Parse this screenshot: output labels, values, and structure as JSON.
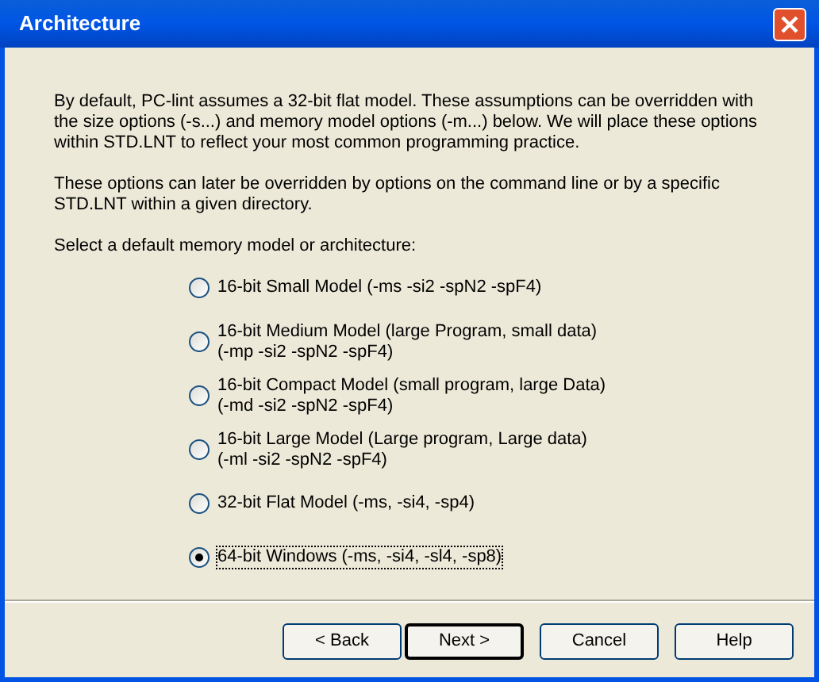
{
  "window": {
    "title": "Architecture"
  },
  "paragraphs": [
    "By default, PC-lint assumes a 32-bit flat model.  These assumptions can be overridden with the size options (-s...) and memory model options (-m...) below.  We will place these options within STD.LNT to reflect your most common programming practice.",
    "These options can later be overridden by options on the command line or by a specific STD.LNT within a given directory."
  ],
  "prompt": "Select a default memory model or architecture:",
  "options": [
    {
      "lines": [
        "16-bit Small Model (-ms -si2 -spN2 -spF4)"
      ],
      "selected": false
    },
    {
      "lines": [
        "16-bit Medium Model (large Program, small data)",
        "(-mp -si2 -spN2 -spF4)"
      ],
      "selected": false
    },
    {
      "lines": [
        "16-bit Compact Model (small program, large Data)",
        "(-md -si2 -spN2 -spF4)"
      ],
      "selected": false
    },
    {
      "lines": [
        "16-bit Large Model (Large program, Large data)",
        "(-ml -si2 -spN2 -spF4)"
      ],
      "selected": false
    },
    {
      "lines": [
        "32-bit Flat Model (-ms, -si4, -sp4)"
      ],
      "selected": false
    },
    {
      "lines": [
        "64-bit Windows (-ms, -si4, -sl4, -sp8)"
      ],
      "selected": true
    }
  ],
  "buttons": [
    {
      "label": "< Back",
      "default": false
    },
    {
      "label": "Next >",
      "default": true
    },
    {
      "label": "Cancel",
      "default": false
    },
    {
      "label": "Help",
      "default": false
    }
  ]
}
